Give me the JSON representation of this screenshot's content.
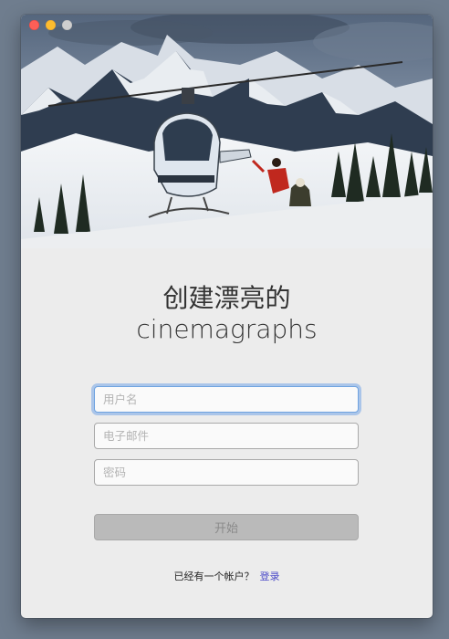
{
  "window": {
    "controls": [
      "close",
      "minimize",
      "zoom"
    ]
  },
  "hero": {
    "image": "helicopter-mountain-photo",
    "colors": {
      "sky": "#5d6f85",
      "snow": "#e8ecf1",
      "rock": "#2d3b4c",
      "jacket": "#c0281e",
      "helicopter": "#dfe6ee"
    }
  },
  "headline": {
    "line1": "创建漂亮的",
    "line2": "cinemagraphs"
  },
  "form": {
    "username_placeholder": "用户名",
    "email_placeholder": "电子邮件",
    "password_placeholder": "密码",
    "submit_label": "开始"
  },
  "footer": {
    "prompt": "已经有一个帐户？",
    "login_label": "登录"
  },
  "colors": {
    "window_bg": "#ececec",
    "focus_ring": "#74a6e8",
    "link": "#4a49c8",
    "button_bg": "#bababa"
  }
}
